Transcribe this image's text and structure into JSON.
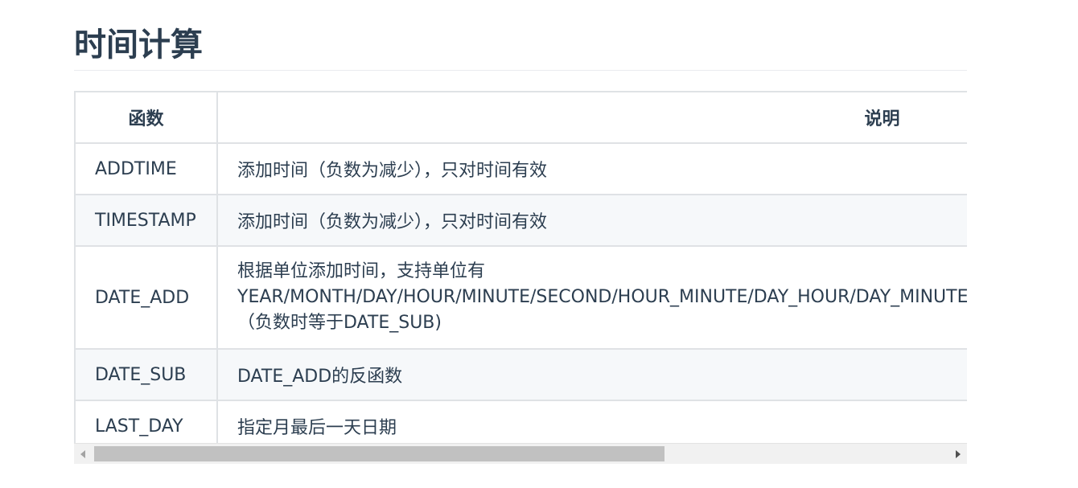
{
  "section": {
    "title": "时间计算"
  },
  "table": {
    "headers": [
      "函数",
      "说明"
    ],
    "rows": [
      {
        "name": "ADDTIME",
        "description": "添加时间（负数为减少），只对时间有效"
      },
      {
        "name": "TIMESTAMP",
        "description": "添加时间（负数为减少），只对时间有效"
      },
      {
        "name": "DATE_ADD",
        "description_lines": [
          "根据单位添加时间，支持单位有",
          "YEAR/MONTH/DAY/HOUR/MINUTE/SECOND/HOUR_MINUTE/DAY_HOUR/DAY_MINUTE/DAY_SECOND/YEAR_MONTH",
          "（负数时等于DATE_SUB)"
        ]
      },
      {
        "name": "DATE_SUB",
        "description": "DATE_ADD的反函数"
      },
      {
        "name": "LAST_DAY",
        "description": "指定月最后一天日期"
      }
    ]
  },
  "scrollbar": {
    "horizontal_position": 0.0
  }
}
